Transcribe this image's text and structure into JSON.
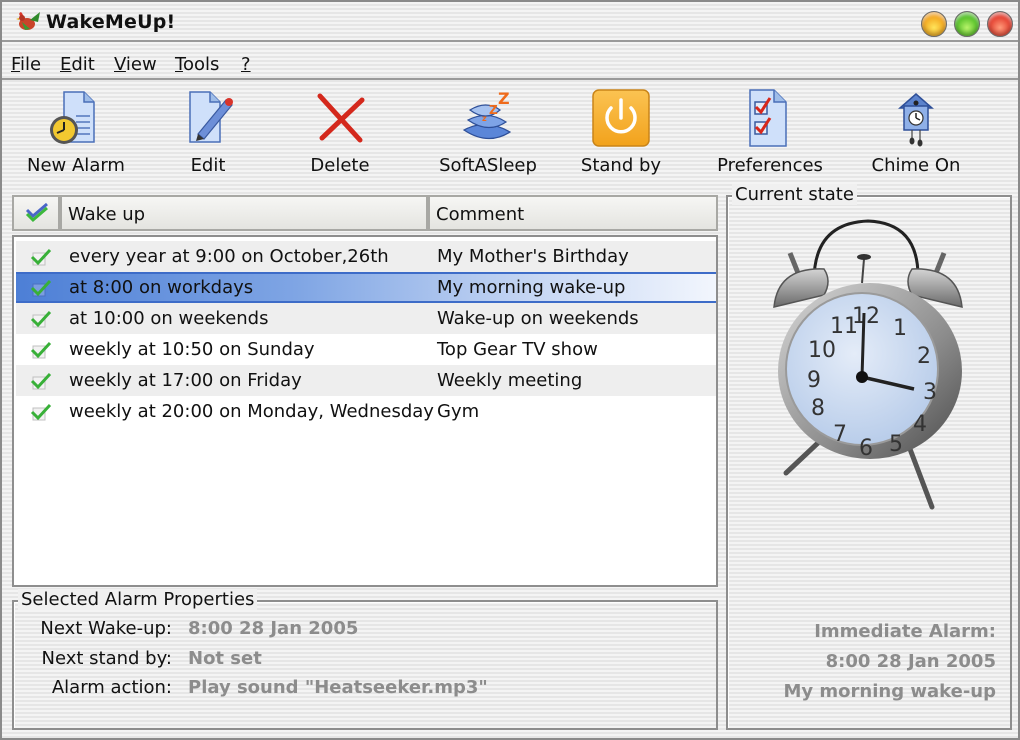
{
  "window": {
    "title": "WakeMeUp!",
    "controls": {
      "minimize": "minimize",
      "maximize": "maximize",
      "close": "close"
    }
  },
  "menu": {
    "items": [
      {
        "label": "File",
        "accel": "F"
      },
      {
        "label": "Edit",
        "accel": "E"
      },
      {
        "label": "View",
        "accel": "V"
      },
      {
        "label": "Tools",
        "accel": "T"
      },
      {
        "label": "?",
        "accel": "?"
      }
    ]
  },
  "toolbar": {
    "items": [
      {
        "label": "New Alarm",
        "icon": "new-alarm-icon"
      },
      {
        "label": "Edit",
        "icon": "edit-icon"
      },
      {
        "label": "Delete",
        "icon": "delete-icon"
      },
      {
        "label": "SoftASleep",
        "icon": "sleep-icon"
      },
      {
        "label": "Stand by",
        "icon": "power-icon"
      },
      {
        "label": "Preferences",
        "icon": "preferences-icon"
      },
      {
        "label": "Chime On",
        "icon": "cuckoo-clock-icon"
      }
    ]
  },
  "alarm_list": {
    "columns": {
      "check": "",
      "wake_up": "Wake up",
      "comment": "Comment"
    },
    "selected_index": 1,
    "rows": [
      {
        "enabled": true,
        "wake_up": "every year at 9:00 on October,26th",
        "comment": "My Mother's Birthday"
      },
      {
        "enabled": true,
        "wake_up": "at 8:00 on workdays",
        "comment": "My morning wake-up"
      },
      {
        "enabled": true,
        "wake_up": "at 10:00 on weekends",
        "comment": "Wake-up on weekends"
      },
      {
        "enabled": true,
        "wake_up": "weekly at 10:50 on Sunday",
        "comment": "Top Gear TV show"
      },
      {
        "enabled": true,
        "wake_up": "weekly at 17:00 on Friday",
        "comment": "Weekly meeting"
      },
      {
        "enabled": true,
        "wake_up": "weekly at 20:00 on Monday, Wednesday",
        "comment": "Gym"
      }
    ]
  },
  "properties": {
    "title": "Selected Alarm Properties",
    "next_wakeup_label": "Next Wake-up:",
    "next_wakeup_value": "8:00 28 Jan 2005",
    "next_standby_label": "Next stand by:",
    "next_standby_value": "Not set",
    "alarm_action_label": "Alarm action:",
    "alarm_action_value": "Play sound \"Heatseeker.mp3\""
  },
  "current_state": {
    "title": "Current state",
    "clock_numerals": [
      "12",
      "1",
      "2",
      "3",
      "4",
      "5",
      "6",
      "7",
      "8",
      "9",
      "10",
      "11"
    ],
    "clock_time": "3:00",
    "immediate_label": "Immediate Alarm:",
    "immediate_time": "8:00 28 Jan 2005",
    "immediate_comment": "My morning wake-up"
  },
  "colors": {
    "selection": "#4d7fd6",
    "disabled_text": "#8c8c8c",
    "check_green": "#3cb83c"
  }
}
